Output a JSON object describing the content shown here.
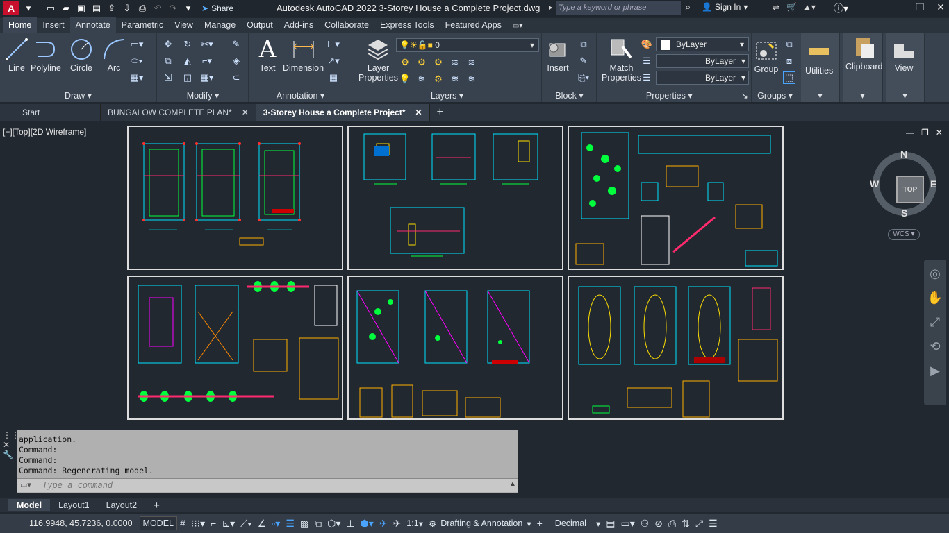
{
  "app": {
    "title": "Autodesk AutoCAD 2022   3-Storey House a Complete Project.dwg",
    "share_label": "Share",
    "search_placeholder": "Type a keyword or phrase",
    "sign_in": "Sign In"
  },
  "ribbon_tabs": [
    "Home",
    "Insert",
    "Annotate",
    "Parametric",
    "View",
    "Manage",
    "Output",
    "Add-ins",
    "Collaborate",
    "Express Tools",
    "Featured Apps"
  ],
  "panels": {
    "draw": {
      "title": "Draw",
      "tools": [
        "Line",
        "Polyline",
        "Circle",
        "Arc"
      ]
    },
    "modify": {
      "title": "Modify"
    },
    "annotation": {
      "title": "Annotation",
      "tools": [
        "Text",
        "Dimension"
      ]
    },
    "layers": {
      "title": "Layers",
      "layer_properties": "Layer\nProperties",
      "current_layer": "0"
    },
    "block": {
      "title": "Block",
      "insert": "Insert"
    },
    "properties": {
      "title": "Properties",
      "match": "Match\nProperties",
      "color": "ByLayer",
      "linetype": "ByLayer",
      "lineweight": "ByLayer"
    },
    "groups": {
      "title": "Groups",
      "group": "Group"
    },
    "utilities": {
      "label": "Utilities"
    },
    "clipboard": {
      "label": "Clipboard"
    },
    "view": {
      "label": "View"
    }
  },
  "doc_tabs": [
    {
      "label": "Start",
      "active": false
    },
    {
      "label": "BUNGALOW COMPLETE PLAN*",
      "active": false
    },
    {
      "label": "3-Storey House a Complete Project*",
      "active": true
    }
  ],
  "viewport": {
    "label": "[−][Top][2D Wireframe]",
    "viewcube_face": "TOP",
    "compass": {
      "n": "N",
      "s": "S",
      "e": "E",
      "w": "W"
    },
    "ucs": "WCS"
  },
  "command_history": [
    "application.",
    "Command:",
    "Command:",
    "Command: Regenerating model."
  ],
  "command_placeholder": "Type a command",
  "layout_tabs": [
    {
      "label": "Model",
      "active": true
    },
    {
      "label": "Layout1",
      "active": false
    },
    {
      "label": "Layout2",
      "active": false
    }
  ],
  "status": {
    "coordinates": "116.9948, 45.7236, 0.0000",
    "space": "MODEL",
    "scale": "1:1",
    "workspace": "Drafting & Annotation",
    "units": "Decimal"
  }
}
